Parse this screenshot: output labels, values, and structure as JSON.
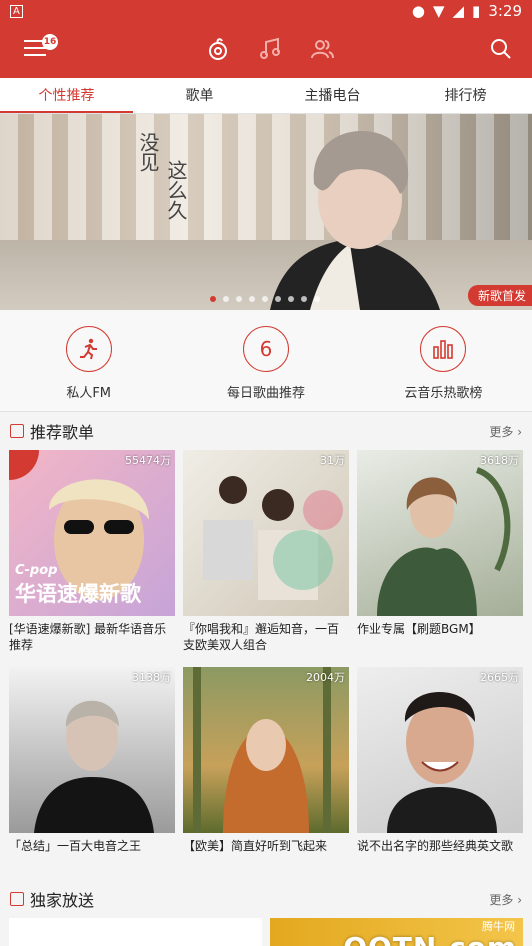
{
  "status_bar": {
    "carrier_icon": "A",
    "time": "3:29"
  },
  "app_bar": {
    "badge_count": "16"
  },
  "tabs": [
    {
      "label": "个性推荐"
    },
    {
      "label": "歌单"
    },
    {
      "label": "主播电台"
    },
    {
      "label": "排行榜"
    }
  ],
  "banner": {
    "poem_line1": "没见",
    "poem_line2": "这么久",
    "tag": "新歌首发",
    "dot_count": 9,
    "active_dot": 0
  },
  "shortcuts": [
    {
      "label": "私人FM",
      "icon": "runner-icon"
    },
    {
      "label": "每日歌曲推荐",
      "icon_text": "6"
    },
    {
      "label": "云音乐热歌榜",
      "icon": "chart-bars-icon"
    }
  ],
  "recommended": {
    "title": "推荐歌单",
    "more": "更多",
    "playlists": [
      {
        "plays": "55474万",
        "caption": "[华语速爆新歌] 最新华语音乐推荐",
        "cover_small": "C-pop",
        "cover_big": "华语速爆新歌"
      },
      {
        "plays": "31万",
        "caption": "『你唱我和』邂逅知音，一百支欧美双人组合"
      },
      {
        "plays": "3618万",
        "caption": "作业专属【刷题BGM】"
      },
      {
        "plays": "3138万",
        "caption": "「总结」一百大电音之王"
      },
      {
        "plays": "2004万",
        "caption": "【欧美】简直好听到飞起来"
      },
      {
        "plays": "2665万",
        "caption": "说不出名字的那些经典英文歌"
      }
    ]
  },
  "exclusive": {
    "title": "独家放送",
    "more": "更多"
  },
  "watermark": {
    "text": "QQTN.com",
    "sub": "腾牛网"
  },
  "colors": {
    "accent": "#d33a31"
  }
}
